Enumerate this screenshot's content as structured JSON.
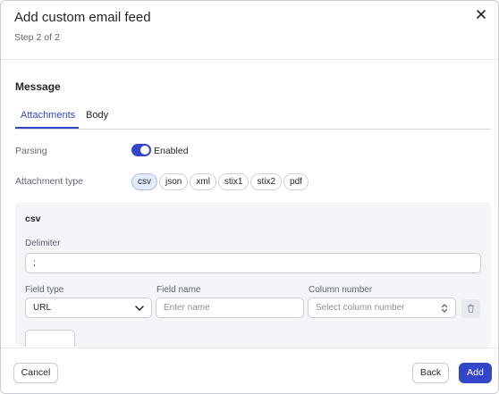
{
  "dialog": {
    "title": "Add custom email feed",
    "subtitle": "Step 2 of 2",
    "close_icon": "close-icon"
  },
  "message": {
    "section_title": "Message",
    "tabs": [
      {
        "label": "Attachments",
        "active": true
      },
      {
        "label": "Body",
        "active": false
      }
    ]
  },
  "parsing": {
    "label": "Parsing",
    "toggle_state": "on",
    "toggle_label": "Enabled"
  },
  "attachment_type": {
    "label": "Attachment type",
    "options": [
      "csv",
      "json",
      "xml",
      "stix1",
      "stix2",
      "pdf"
    ],
    "selected": "csv"
  },
  "csv_panel": {
    "title": "csv",
    "delimiter": {
      "label": "Delimiter",
      "value": ";"
    },
    "field_type": {
      "label": "Field type",
      "value": "URL"
    },
    "field_name": {
      "label": "Field name",
      "placeholder": "Enter name"
    },
    "column_number": {
      "label": "Column number",
      "placeholder": "Select column number"
    },
    "delete_icon": "trash-icon"
  },
  "footer": {
    "cancel_label": "Cancel",
    "back_label": "Back",
    "add_label": "Add"
  },
  "colors": {
    "accent": "#3346c8",
    "tab_active": "#2f47c9",
    "chip_selected_bg": "#e4ecfb",
    "panel_bg": "#f3f5f9"
  }
}
